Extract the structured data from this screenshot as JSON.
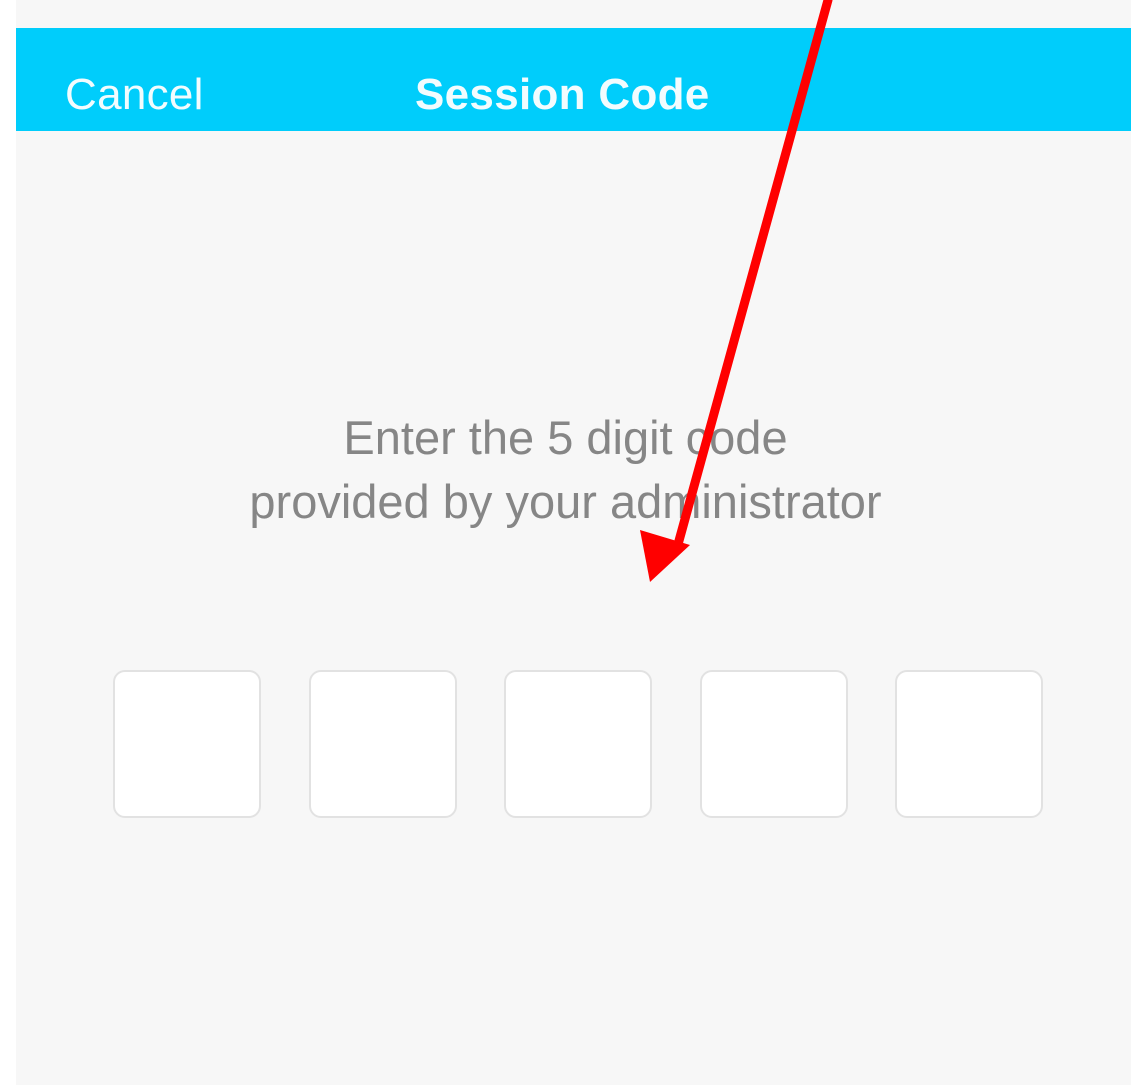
{
  "navbar": {
    "cancel_label": "Cancel",
    "title": "Session Code",
    "background_color": "#00cdfb"
  },
  "instructions": {
    "line1": "Enter the 5 digit code",
    "line2": "provided by your administrator"
  },
  "code_inputs": [
    "",
    "",
    "",
    "",
    ""
  ],
  "annotation": {
    "arrow_color": "#ff0000",
    "icon": "red-arrow-icon"
  }
}
